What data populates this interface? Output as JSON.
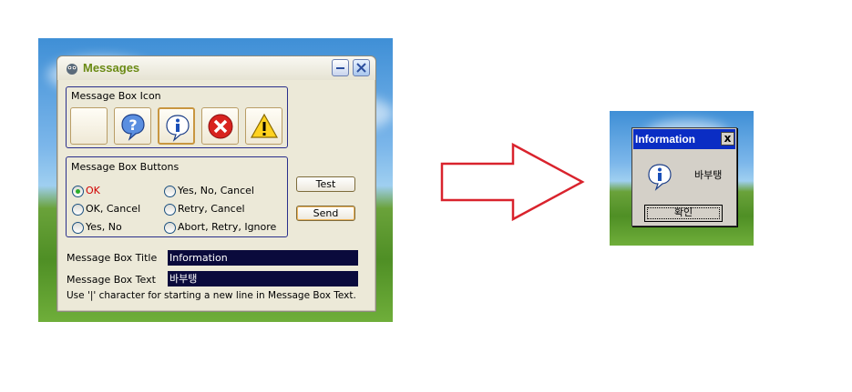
{
  "window": {
    "title": "Messages"
  },
  "icon_group": {
    "label": "Message Box Icon",
    "icons": [
      {
        "name": "none",
        "selected": false
      },
      {
        "name": "question-icon",
        "selected": false
      },
      {
        "name": "information-icon",
        "selected": true
      },
      {
        "name": "error-icon",
        "selected": false
      },
      {
        "name": "warning-icon",
        "selected": false
      }
    ]
  },
  "buttons_group": {
    "label": "Message Box Buttons",
    "options": [
      {
        "label": "OK",
        "checked": true
      },
      {
        "label": "OK, Cancel",
        "checked": false
      },
      {
        "label": "Yes, No",
        "checked": false
      },
      {
        "label": "Yes, No, Cancel",
        "checked": false
      },
      {
        "label": "Retry, Cancel",
        "checked": false
      },
      {
        "label": "Abort, Retry, Ignore",
        "checked": false
      }
    ]
  },
  "actions": {
    "test_label": "Test",
    "send_label": "Send"
  },
  "fields": {
    "title_label": "Message Box Title",
    "title_value": "Information",
    "text_label": "Message Box Text",
    "text_value": "바부탱"
  },
  "hint": "Use '|' character for starting a new line in Message Box Text.",
  "result_box": {
    "title": "Information",
    "close_glyph": "x",
    "message": "바부탱",
    "ok_label": "확인",
    "icon": "information-icon"
  },
  "colors": {
    "arrow": "#d9232d",
    "field_bg": "#0a0a3c",
    "title_accent": "#6a8a14",
    "mb_titlebar": "#0a2dc4"
  }
}
